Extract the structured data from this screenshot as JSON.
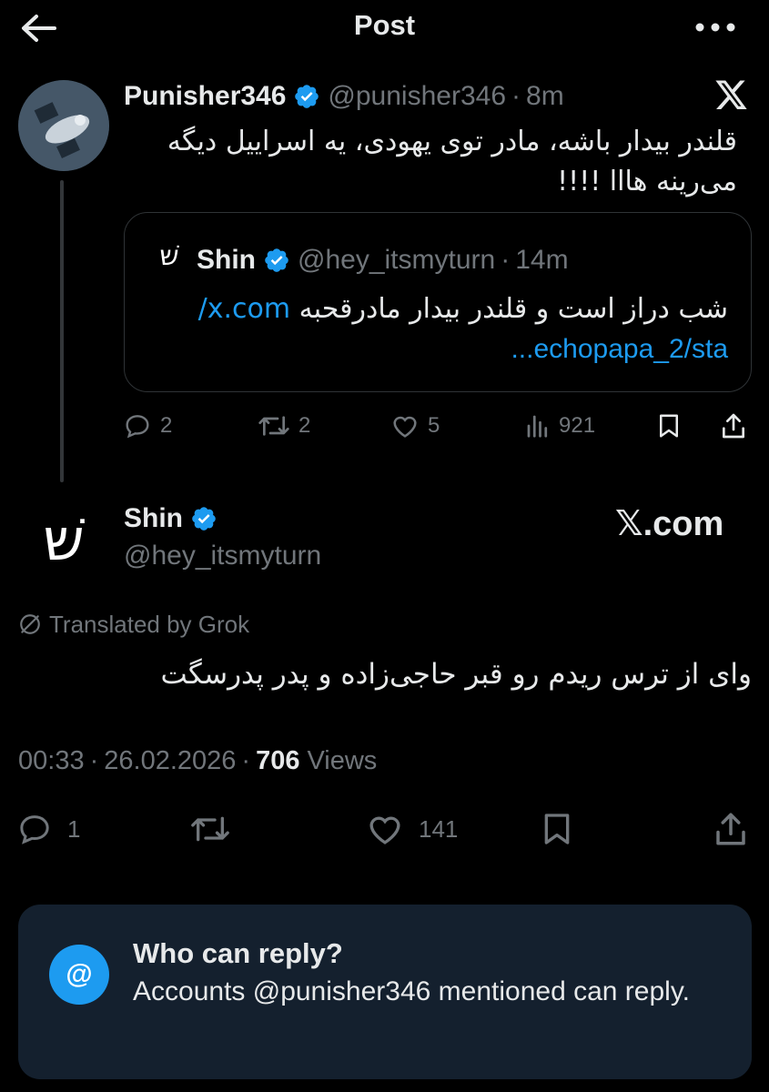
{
  "header": {
    "title": "Post"
  },
  "parent_tweet": {
    "name": "Punisher346",
    "handle": "@punisher346",
    "separator": "·",
    "time": "8m",
    "text_line1": "قلندر بیدار باشه، مادر توی یهودی، یه اسراییل دیگه",
    "text_line2": "می‌رینه هااا !!!!",
    "quote": {
      "avatar_glyph": "שׁ",
      "name": "Shin",
      "handle": "@hey_itsmyturn",
      "time": "14m",
      "text": "شب دراز است و قلندر بیدار مادرقحبه",
      "link_part1": "x.com/",
      "link_part2": "echopapa_2/sta..."
    },
    "actions": {
      "replies": "2",
      "reposts": "2",
      "likes": "5",
      "views": "921"
    }
  },
  "main_tweet": {
    "avatar_glyph": "שׁ",
    "name": "Shin",
    "handle": "@hey_itsmyturn",
    "source": "𝕏.com",
    "translated_label": "Translated by Grok",
    "text": "وای از ترس ریدم رو قبر حاجی‌زاده و پدر پدرسگت",
    "time": "00:33",
    "date": "26.02.2026",
    "views_count": "706",
    "views_label": "Views",
    "actions": {
      "replies": "1",
      "likes": "141"
    }
  },
  "reply_restriction": {
    "icon": "@",
    "title": "Who can reply?",
    "body": "Accounts @punisher346 mentioned can reply."
  },
  "colors": {
    "background": "#000000",
    "accent": "#1d9bf0",
    "muted": "#71767b",
    "card": "#14202e"
  }
}
